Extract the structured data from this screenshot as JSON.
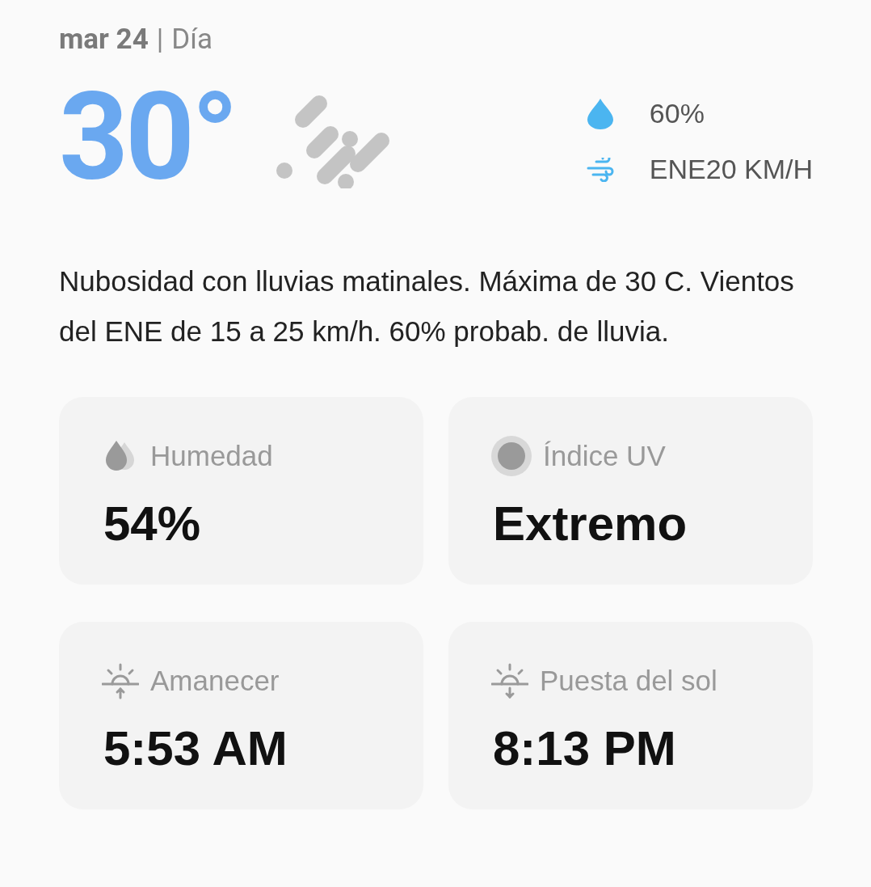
{
  "header": {
    "date": "mar 24",
    "separator": "|",
    "period": "Día"
  },
  "current": {
    "temperature": "30°",
    "precipitation": "60%",
    "wind": "ENE20 KM/H"
  },
  "description": "Nubosidad con lluvias matinales. Máxima de 30 C. Vientos del ENE de 15 a 25 km/h. 60% probab. de lluvia.",
  "cards": [
    {
      "kind": "humidity",
      "label": "Humedad",
      "value": "54%"
    },
    {
      "kind": "uv",
      "label": "Índice UV",
      "value": "Extremo"
    },
    {
      "kind": "sunrise",
      "label": "Amanecer",
      "value": "5:53 AM"
    },
    {
      "kind": "sunset",
      "label": "Puesta del sol",
      "value": "8:13 PM"
    }
  ]
}
